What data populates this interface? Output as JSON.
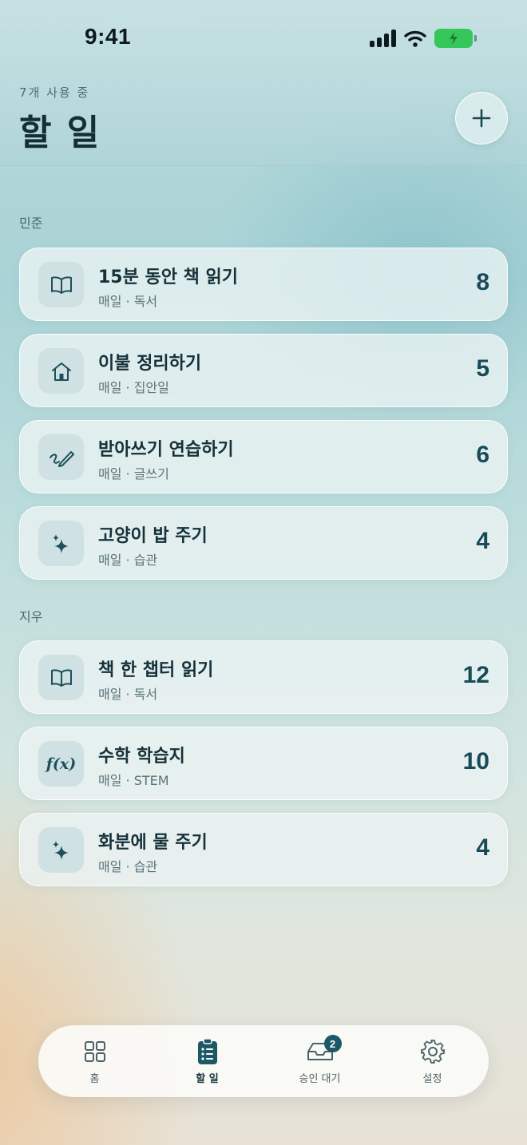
{
  "status_bar": {
    "time": "9:41"
  },
  "header": {
    "subtitle": "7개 사용 중",
    "title": "할 일",
    "add_label": "+"
  },
  "sections": [
    {
      "name": "민준",
      "tasks": [
        {
          "title": "15분 동안 책 읽기",
          "meta": "매일 · 독서",
          "points": "8",
          "icon": "book-icon"
        },
        {
          "title": "이불 정리하기",
          "meta": "매일 · 집안일",
          "points": "5",
          "icon": "house-icon"
        },
        {
          "title": "받아쓰기 연습하기",
          "meta": "매일 · 글쓰기",
          "points": "6",
          "icon": "pencil-scribble-icon"
        },
        {
          "title": "고양이 밥 주기",
          "meta": "매일 · 습관",
          "points": "4",
          "icon": "sparkles-icon"
        }
      ]
    },
    {
      "name": "지우",
      "tasks": [
        {
          "title": "책 한 챕터 읽기",
          "meta": "매일 · 독서",
          "points": "12",
          "icon": "book-icon"
        },
        {
          "title": "수학 학습지",
          "meta": "매일 · STEM",
          "points": "10",
          "icon": "function-icon",
          "icon_text": "f(x)"
        },
        {
          "title": "화분에 물 주기",
          "meta": "매일 · 습관",
          "points": "4",
          "icon": "sparkles-icon"
        }
      ]
    }
  ],
  "tabbar": {
    "tabs": [
      {
        "label": "홈",
        "icon": "grid-icon"
      },
      {
        "label": "할 일",
        "icon": "clipboard-list-icon",
        "active": true
      },
      {
        "label": "승인 대기",
        "icon": "inbox-icon",
        "badge": "2"
      },
      {
        "label": "설정",
        "icon": "gear-icon"
      }
    ]
  },
  "colors": {
    "accent": "#184b58",
    "battery": "#35c759",
    "badge": "#1d5866"
  }
}
